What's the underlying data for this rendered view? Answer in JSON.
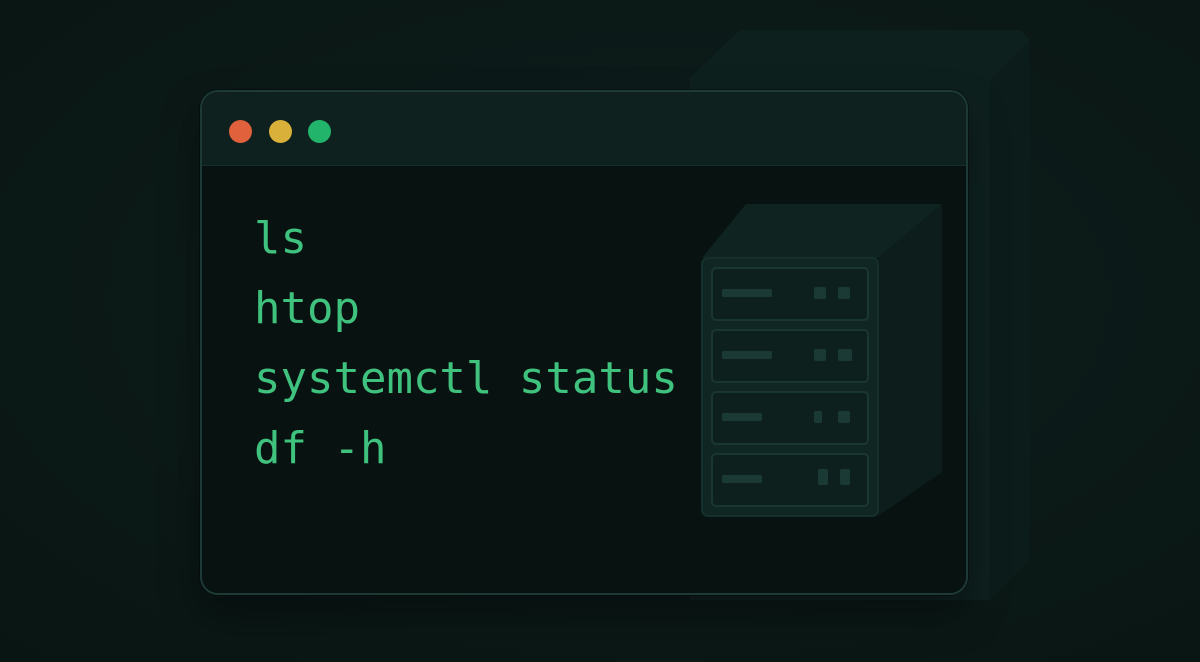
{
  "terminal": {
    "commands": [
      "ls",
      "htop",
      "systemctl status",
      "df -h"
    ]
  },
  "colors": {
    "background": "#0b1917",
    "window": "#081311",
    "titlebar": "#0e211f",
    "text": "#3fc27e",
    "close": "#e0613b",
    "minimize": "#d9b03a",
    "maximize": "#23b46b"
  },
  "icons": [
    "close-dot-icon",
    "minimize-dot-icon",
    "maximize-dot-icon",
    "server-rack-icon"
  ]
}
